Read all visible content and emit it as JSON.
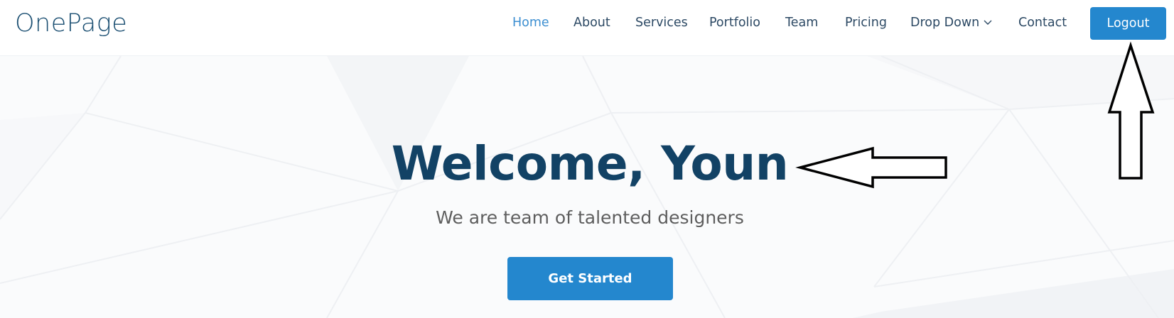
{
  "header": {
    "logo": "OnePage",
    "nav": [
      {
        "label": "Home",
        "active": true
      },
      {
        "label": "About"
      },
      {
        "label": "Services"
      },
      {
        "label": "Portfolio"
      },
      {
        "label": "Team"
      },
      {
        "label": "Pricing"
      },
      {
        "label": "Drop Down",
        "icon": "chevron-down-icon"
      },
      {
        "label": "Contact"
      }
    ],
    "logout_label": "Logout"
  },
  "hero": {
    "title": "Welcome, Youn",
    "subtitle": "We are team of talented designers",
    "cta_label": "Get Started"
  },
  "colors": {
    "brand": "#2487ce",
    "heading": "#124265",
    "nav_text": "#2c4964",
    "nav_active": "#3d8fd1"
  },
  "annotations": [
    "arrow-left-icon",
    "arrow-up-icon"
  ]
}
